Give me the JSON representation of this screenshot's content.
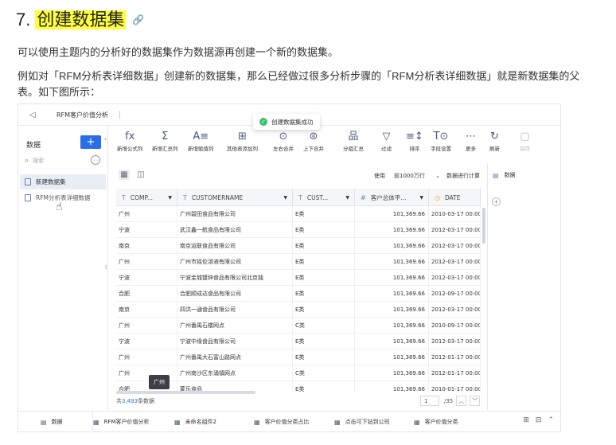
{
  "doc": {
    "heading_num": "7.",
    "heading_text": "创建数据集",
    "p1": "可以使用主题内的分析好的数据集作为数据源再创建一个新的数据集。",
    "p2": "例如对「RFM分析表详细数据」创建新的数据集，那么已经做过很多分析步骤的「RFM分析表详细数据」就是新数据集的父表。如下图所示："
  },
  "app": {
    "title": "RFM客户价值分析",
    "toast": "创建数据集成功",
    "sidebar": {
      "header": "数据",
      "add_label": "+",
      "search_placeholder": "搜索",
      "items": [
        {
          "label": "新建数据集"
        },
        {
          "label": "RFM分析表详细数据"
        }
      ]
    },
    "toolbar": [
      {
        "icon": "fx",
        "label": "新增公式列"
      },
      {
        "icon": "Σ",
        "label": "新增汇总列"
      },
      {
        "icon": "A≡",
        "label": "新增赋值列"
      },
      {
        "icon": "⊞",
        "label": "其他表添加列"
      },
      {
        "icon": "⊙",
        "label": "左右合并"
      },
      {
        "icon": "⊜",
        "label": "上下合并"
      },
      {
        "icon": "品",
        "label": "分组汇总"
      },
      {
        "icon": "▽",
        "label": "过滤"
      },
      {
        "icon": "≡↕",
        "label": "排序"
      },
      {
        "icon": "T⊙",
        "label": "字段设置"
      },
      {
        "icon": "⋯",
        "label": "更多"
      },
      {
        "icon": "↻",
        "label": "刷新"
      },
      {
        "icon": "▢",
        "label": "保存"
      }
    ],
    "subbar": {
      "use_label": "使用",
      "rows_select": "前1000万行",
      "calc_label": "数据进行计算"
    },
    "table": {
      "columns": [
        {
          "label": "COMP...",
          "type": "text"
        },
        {
          "label": "CUSTOMERNAME",
          "type": "text"
        },
        {
          "label": "CUST...",
          "type": "text"
        },
        {
          "label": "客户总体平...",
          "type": "number"
        },
        {
          "label": "DATE",
          "type": "date"
        }
      ],
      "rows": [
        [
          "广州",
          "广州碧田食品有限公司",
          "E类",
          "101,369.66",
          "2010-03-17 00:00:0"
        ],
        [
          "宁波",
          "武汉鑫一航食品有限公司",
          "E类",
          "101,369.66",
          "2012-03-17 00:00:0"
        ],
        [
          "南京",
          "南京运联食品有限公司",
          "E类",
          "101,369.66",
          "2012-03-17 00:00:0"
        ],
        [
          "广州",
          "广州市摇伦溶液有限公司",
          "E类",
          "101,369.66",
          "2012-03-17 00:00:0"
        ],
        [
          "宁波",
          "宁波金城镀锌食品有限公司北京独",
          "E类",
          "101,369.66",
          "2012-03-17 00:00:0"
        ],
        [
          "合肥",
          "合肥顺成达食品有限公司",
          "E类",
          "101,369.66",
          "2012-09-17 00:00:0"
        ],
        [
          "南京",
          "四洪一通食品有限公司",
          "E类",
          "101,369.66",
          "2012-03-17 00:00:0"
        ],
        [
          "广州",
          "广州番禺石楼网点",
          "C类",
          "101,369.66",
          "2010-09-17 00:00:0"
        ],
        [
          "宁波",
          "宁波中缘食品有限公司",
          "E类",
          "101,369.66",
          "2012-03-17 00:00:0"
        ],
        [
          "广州",
          "广州番禺大石富山路网点",
          "E类",
          "101,369.66",
          "2012-01-17 00:00:0"
        ],
        [
          "广州",
          "广州南沙区东涌镇网点",
          "C类",
          "101,369.66",
          "2012-01-17 00:00:0"
        ],
        [
          "合肥",
          "蒙乐食品",
          "E类",
          "101,369.66",
          "2010-01-17 00:00:0"
        ]
      ],
      "tooltip": "广州"
    },
    "footer": {
      "total_prefix": "共",
      "total_count": "3,493",
      "total_suffix": "条数据",
      "page": "1",
      "pages": "/35"
    },
    "right_panel": {
      "item": "数据",
      "add_label": "+"
    },
    "bottom_tabs": [
      {
        "icon": "▤",
        "label": "数据"
      },
      {
        "icon": "▦",
        "label": "RFM客户价值分析"
      },
      {
        "icon": "▦",
        "label": "未命名组件2"
      },
      {
        "icon": "▦",
        "label": "客户价值分类占比"
      },
      {
        "icon": "▦",
        "label": "点击可下钻到公司"
      },
      {
        "icon": "▦",
        "label": "客户价值分类"
      }
    ]
  }
}
